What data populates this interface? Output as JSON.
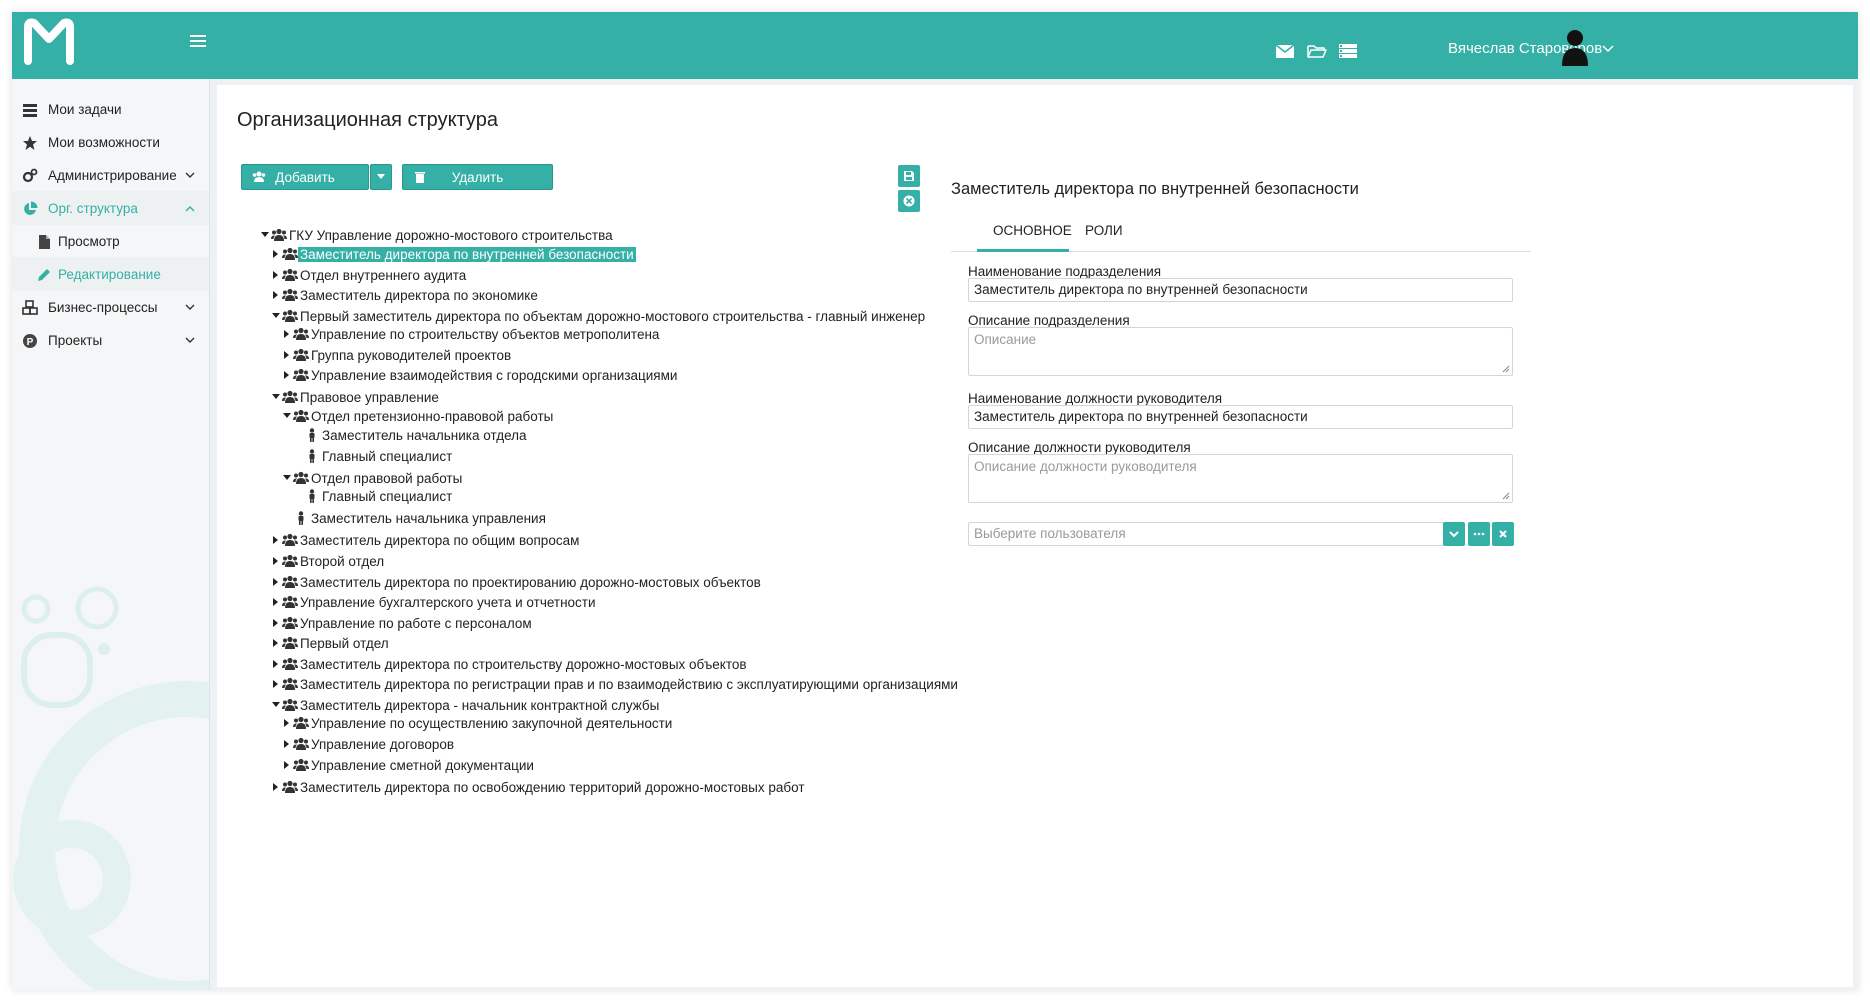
{
  "header": {
    "username": "Вячеслав Староверов"
  },
  "sidebar": {
    "items": [
      {
        "label": "Мои задачи"
      },
      {
        "label": "Мои возможности"
      },
      {
        "label": "Администрирование"
      },
      {
        "label": "Орг. структура"
      },
      {
        "label": "Просмотр"
      },
      {
        "label": "Редактирование"
      },
      {
        "label": "Бизнес-процессы"
      },
      {
        "label": "Проекты"
      }
    ]
  },
  "page": {
    "title": "Организационная структура"
  },
  "toolbar": {
    "add_label": "Добавить",
    "delete_label": "Удалить"
  },
  "tree": [
    {
      "label": "ГКУ Управление дорожно-мостового строительства",
      "level": 0,
      "kind": "group",
      "state": "expanded"
    },
    {
      "label": "Заместитель директора по внутренней безопасности",
      "level": 1,
      "kind": "group",
      "state": "collapsed",
      "selected": true
    },
    {
      "label": "Отдел внутреннего аудита",
      "level": 1,
      "kind": "group",
      "state": "collapsed"
    },
    {
      "label": "Заместитель директора по экономике",
      "level": 1,
      "kind": "group",
      "state": "collapsed"
    },
    {
      "label": "Первый заместитель директора по объектам дорожно-мостового строительства - главный инженер",
      "level": 1,
      "kind": "group",
      "state": "expanded"
    },
    {
      "label": "Управление по строительству объектов метрополитена",
      "level": 2,
      "kind": "group",
      "state": "collapsed"
    },
    {
      "label": "Группа руководителей проектов",
      "level": 2,
      "kind": "group",
      "state": "collapsed"
    },
    {
      "label": "Управление взаимодействия с городскими организациями",
      "level": 2,
      "kind": "group",
      "state": "collapsed"
    },
    {
      "label": "Правовое управление",
      "level": 1,
      "kind": "group",
      "state": "expanded"
    },
    {
      "label": "Отдел претензионно-правовой работы",
      "level": 2,
      "kind": "group",
      "state": "expanded"
    },
    {
      "label": "Заместитель начальника отдела",
      "level": 3,
      "kind": "person",
      "state": "leaf"
    },
    {
      "label": "Главный специалист",
      "level": 3,
      "kind": "person",
      "state": "leaf"
    },
    {
      "label": "Отдел правовой работы",
      "level": 2,
      "kind": "group",
      "state": "expanded"
    },
    {
      "label": "Главный специалист",
      "level": 3,
      "kind": "person",
      "state": "leaf"
    },
    {
      "label": "Заместитель начальника управления",
      "level": 2,
      "kind": "person",
      "state": "leaf"
    },
    {
      "label": "Заместитель директора по общим вопросам",
      "level": 1,
      "kind": "group",
      "state": "collapsed"
    },
    {
      "label": "Второй отдел",
      "level": 1,
      "kind": "group",
      "state": "collapsed"
    },
    {
      "label": "Заместитель директора по проектированию дорожно-мостовых объектов",
      "level": 1,
      "kind": "group",
      "state": "collapsed"
    },
    {
      "label": "Управление бухгалтерского учета и отчетности",
      "level": 1,
      "kind": "group",
      "state": "collapsed"
    },
    {
      "label": "Управление по работе с персоналом",
      "level": 1,
      "kind": "group",
      "state": "collapsed"
    },
    {
      "label": "Первый отдел",
      "level": 1,
      "kind": "group",
      "state": "collapsed"
    },
    {
      "label": "Заместитель директора по строительству дорожно-мостовых объектов",
      "level": 1,
      "kind": "group",
      "state": "collapsed"
    },
    {
      "label": "Заместитель директора по регистрации прав и по взаимодействию с эксплуатирующими организациями",
      "level": 1,
      "kind": "group",
      "state": "collapsed"
    },
    {
      "label": "Заместитель директора - начальник контрактной службы",
      "level": 1,
      "kind": "group",
      "state": "expanded"
    },
    {
      "label": "Управление по осуществлению закупочной деятельности",
      "level": 2,
      "kind": "group",
      "state": "collapsed"
    },
    {
      "label": "Управление договоров",
      "level": 2,
      "kind": "group",
      "state": "collapsed"
    },
    {
      "label": "Управление сметной документации",
      "level": 2,
      "kind": "group",
      "state": "collapsed"
    },
    {
      "label": "Заместитель директора по освобождению территорий дорожно-мостовых работ",
      "level": 1,
      "kind": "group",
      "state": "collapsed"
    }
  ],
  "details": {
    "title": "Заместитель директора по внутренней безопасности",
    "tabs": [
      {
        "label": "ОСНОВНОЕ",
        "active": true
      },
      {
        "label": "РОЛИ",
        "active": false
      }
    ],
    "unit_name_label": "Наименование подразделения",
    "unit_name_value": "Заместитель директора по внутренней безопасности",
    "unit_desc_label": "Описание подразделения",
    "unit_desc_placeholder": "Описание",
    "head_title_label": "Наименование должности руководителя",
    "head_title_value": "Заместитель директора по внутренней безопасности",
    "head_desc_label": "Описание должности руководителя",
    "head_desc_placeholder": "Описание должности руководителя",
    "user_select_placeholder": "Выберите пользователя"
  },
  "colors": {
    "accent": "#35b0a6",
    "header": "#35b0a6",
    "sidebar_bg": "#f5f6f7"
  }
}
